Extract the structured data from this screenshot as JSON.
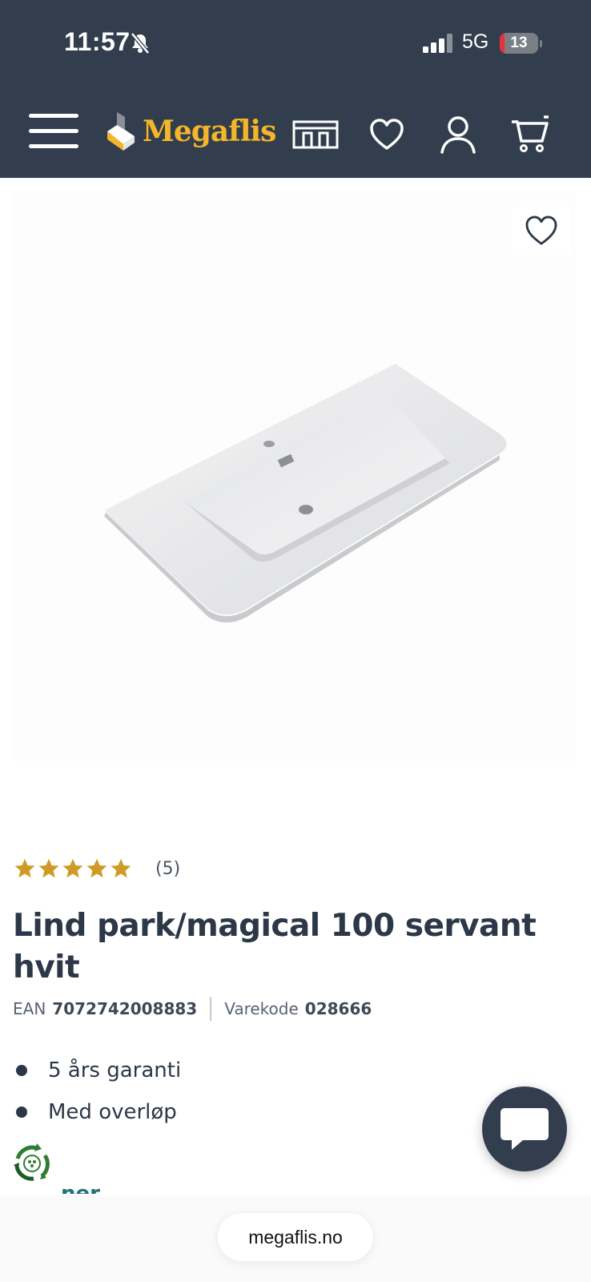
{
  "status_bar": {
    "time": "11:57",
    "network": "5G",
    "battery": "13",
    "battery_level": 0.13,
    "icons": [
      "bell-slash-icon",
      "signal-icon",
      "battery-icon"
    ]
  },
  "header": {
    "logo_text": "Megaflis",
    "icons": [
      "menu-icon",
      "store-icon",
      "heart-icon",
      "user-icon",
      "cart-icon"
    ],
    "colors": {
      "background": "#323e4e",
      "logo": "#f5b52a"
    }
  },
  "product": {
    "rating_value": 5,
    "rating_max": 5,
    "rating_count": "(5)",
    "title": "Lind park/magical 100 servant hvit",
    "ean_label": "EAN",
    "ean_value": "7072742008883",
    "sku_label": "Varekode",
    "sku_value": "028666",
    "features": [
      "5 års garanti",
      "Med overløp"
    ],
    "more_link": "ner",
    "colors": {
      "star": "#d09a24",
      "link": "#20737a"
    }
  },
  "browser": {
    "url": "megaflis.no"
  }
}
